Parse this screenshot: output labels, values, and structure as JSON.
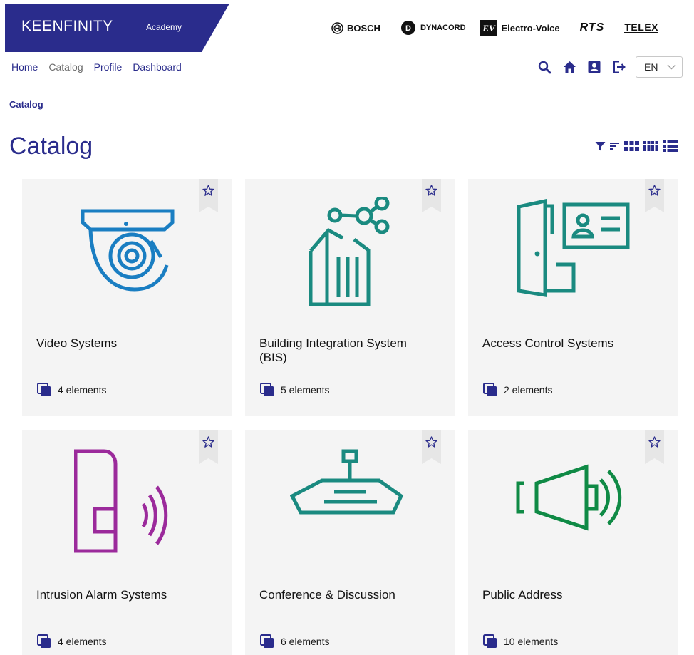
{
  "header": {
    "logo_text": "KEENFINITY",
    "logo_sub": "Academy",
    "brands": [
      "BOSCH",
      "DYNACORD",
      "Electro-Voice",
      "RTS",
      "TELEX"
    ]
  },
  "nav": {
    "items": [
      {
        "label": "Home",
        "active": false
      },
      {
        "label": "Catalog",
        "active": true
      },
      {
        "label": "Profile",
        "active": false
      },
      {
        "label": "Dashboard",
        "active": false
      }
    ]
  },
  "language": {
    "selected": "EN"
  },
  "breadcrumb": {
    "current": "Catalog"
  },
  "page": {
    "title": "Catalog"
  },
  "icons": {
    "search": "search-icon",
    "home": "home-icon",
    "profile": "profile-icon",
    "logout": "logout-icon",
    "filter": "filter-icon",
    "sort": "sort-icon",
    "grid_large": "grid-large-icon",
    "grid_small": "grid-small-icon",
    "list": "list-view-icon"
  },
  "colors": {
    "brand": "#2a2c8c",
    "card_bg": "#f4f4f4",
    "video": "#1a7ec2",
    "teal": "#1a8a80",
    "purple": "#9b2a9b",
    "green": "#0f8a45"
  },
  "catalog": {
    "cards": [
      {
        "title": "Video Systems",
        "count": "4 elements",
        "icon": "camera-icon"
      },
      {
        "title": "Building Integration System (BIS)",
        "count": "5 elements",
        "icon": "building-network-icon"
      },
      {
        "title": "Access Control Systems",
        "count": "2 elements",
        "icon": "door-badge-icon"
      },
      {
        "title": "Intrusion Alarm Systems",
        "count": "4 elements",
        "icon": "motion-sensor-icon"
      },
      {
        "title": "Conference & Discussion",
        "count": "6 elements",
        "icon": "conference-unit-icon"
      },
      {
        "title": "Public Address",
        "count": "10 elements",
        "icon": "loudspeaker-icon"
      }
    ]
  }
}
